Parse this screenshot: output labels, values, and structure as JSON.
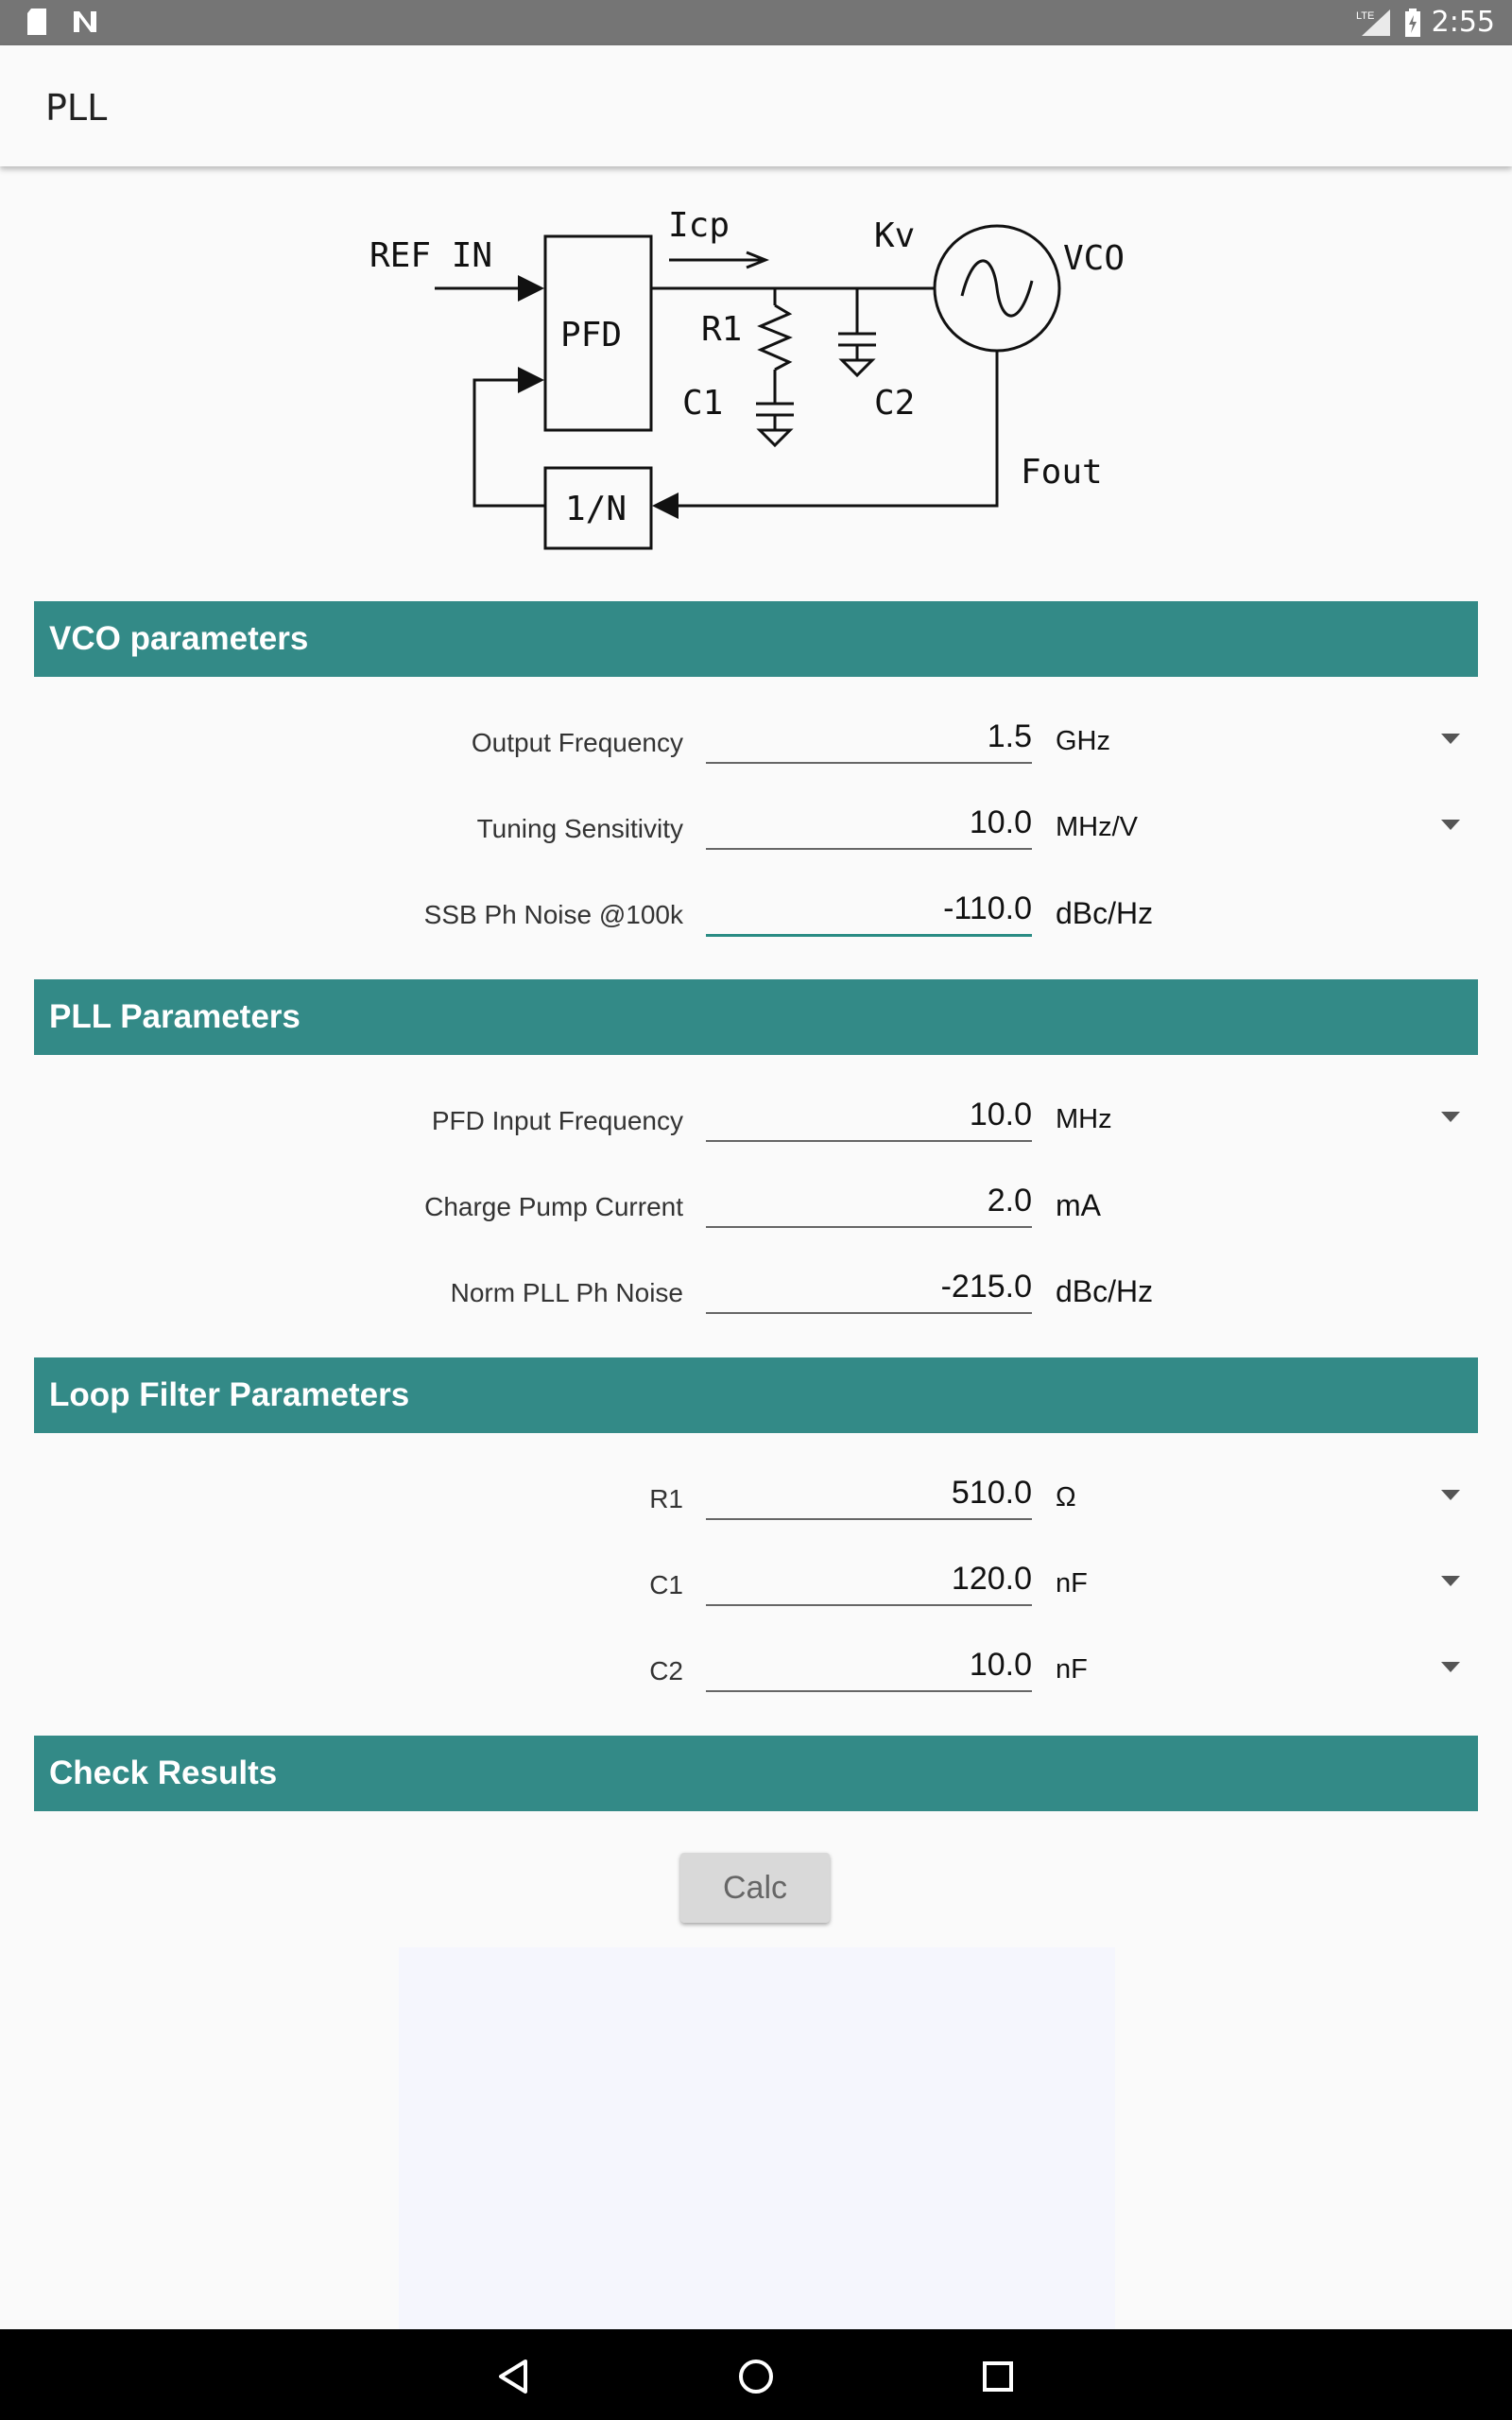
{
  "status_bar": {
    "time": "2:55",
    "network": "LTE"
  },
  "app_bar": {
    "title": "PLL"
  },
  "diagram": {
    "ref_in": "REF IN",
    "pfd": "PFD",
    "icp": "Icp",
    "kv": "Kv",
    "vco": "VCO",
    "r1": "R1",
    "c1": "C1",
    "c2": "C2",
    "divider": "1/N",
    "fout": "Fout"
  },
  "sections": {
    "vco": "VCO parameters",
    "pll": "PLL Parameters",
    "loop": "Loop Filter Parameters",
    "check": "Check Results"
  },
  "vco_params": [
    {
      "label": "Output Frequency",
      "value": "1.5",
      "unit": "GHz",
      "dropdown": true
    },
    {
      "label": "Tuning Sensitivity",
      "value": "10.0",
      "unit": "MHz/V",
      "dropdown": true
    },
    {
      "label": "SSB Ph Noise @100k",
      "value": "-110.0",
      "unit": "dBc/Hz",
      "dropdown": false,
      "focused": true
    }
  ],
  "pll_params": [
    {
      "label": "PFD Input Frequency",
      "value": "10.0",
      "unit": "MHz",
      "dropdown": true
    },
    {
      "label": "Charge Pump Current",
      "value": "2.0",
      "unit": "mA",
      "dropdown": false
    },
    {
      "label": "Norm PLL Ph Noise",
      "value": "-215.0",
      "unit": "dBc/Hz",
      "dropdown": false
    }
  ],
  "loop_params": [
    {
      "label": "R1",
      "value": "510.0",
      "unit": "Ω",
      "dropdown": true
    },
    {
      "label": "C1",
      "value": "120.0",
      "unit": "nF",
      "dropdown": true
    },
    {
      "label": "C2",
      "value": "10.0",
      "unit": "nF",
      "dropdown": true
    }
  ],
  "calc_button": {
    "label": "Calc"
  },
  "colors": {
    "section_header": "#338a87",
    "focus_underline": "#2a8c84"
  }
}
